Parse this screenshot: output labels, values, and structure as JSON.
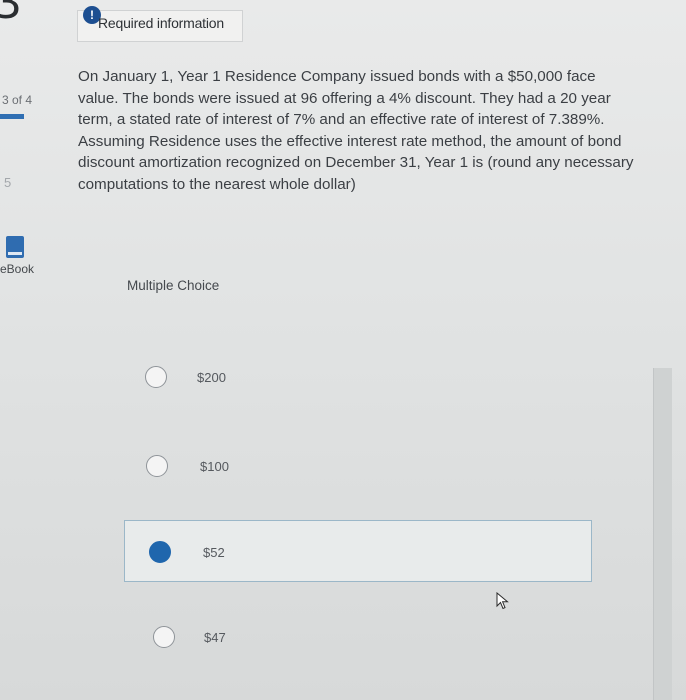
{
  "sidebar": {
    "question_number": "3",
    "question_count_label": "3 of 4",
    "points_label": "5",
    "ebook_label": "eBook"
  },
  "banner": {
    "icon_text": "!",
    "label": "Required information"
  },
  "question": {
    "text": "On January 1, Year 1 Residence Company issued bonds with a $50,000 face value. The bonds were issued at 96 offering a 4% discount. They had a 20 year term, a stated rate of interest of 7% and an effective rate of interest of 7.389%. Assuming Residence uses the effective interest rate method, the amount of bond discount amortization recognized on December 31, Year 1 is (round any necessary computations to the nearest whole dollar)"
  },
  "multiple_choice": {
    "label": "Multiple Choice",
    "selected_index": 2,
    "options": [
      {
        "label": "$200",
        "selected": false
      },
      {
        "label": "$100",
        "selected": false
      },
      {
        "label": "$52",
        "selected": true
      },
      {
        "label": "$47",
        "selected": false
      }
    ]
  },
  "colors": {
    "accent": "#1f66ad",
    "banner_icon": "#1d4f91",
    "progress": "#2f6fb3"
  }
}
